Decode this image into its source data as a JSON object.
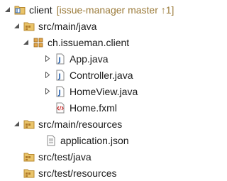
{
  "tree": {
    "project": {
      "name": "client",
      "decoration": "[issue-manager master ↑1]",
      "icon": "java-project-icon"
    },
    "src_main_java": {
      "label": "src/main/java",
      "icon": "source-folder-icon"
    },
    "package": {
      "label": "ch.issueman.client",
      "icon": "package-icon"
    },
    "files": [
      {
        "label": "App.java",
        "icon": "java-file-icon"
      },
      {
        "label": "Controller.java",
        "icon": "java-file-icon"
      },
      {
        "label": "HomeView.java",
        "icon": "java-file-icon"
      },
      {
        "label": "Home.fxml",
        "icon": "fxml-file-icon"
      }
    ],
    "src_main_resources": {
      "label": "src/main/resources",
      "icon": "source-folder-icon"
    },
    "resource_file": {
      "label": "application.json",
      "icon": "text-file-icon"
    },
    "src_test_java": {
      "label": "src/test/java",
      "icon": "source-folder-icon"
    },
    "src_test_resources": {
      "label": "src/test/resources",
      "icon": "source-folder-icon"
    }
  },
  "colors": {
    "decoration": "#9b7b3a",
    "arrow": "#555555",
    "folder": "#dcae50",
    "java_j": "#3a6fb5",
    "package": "#b07a2a",
    "fxml_red": "#cc3333"
  }
}
